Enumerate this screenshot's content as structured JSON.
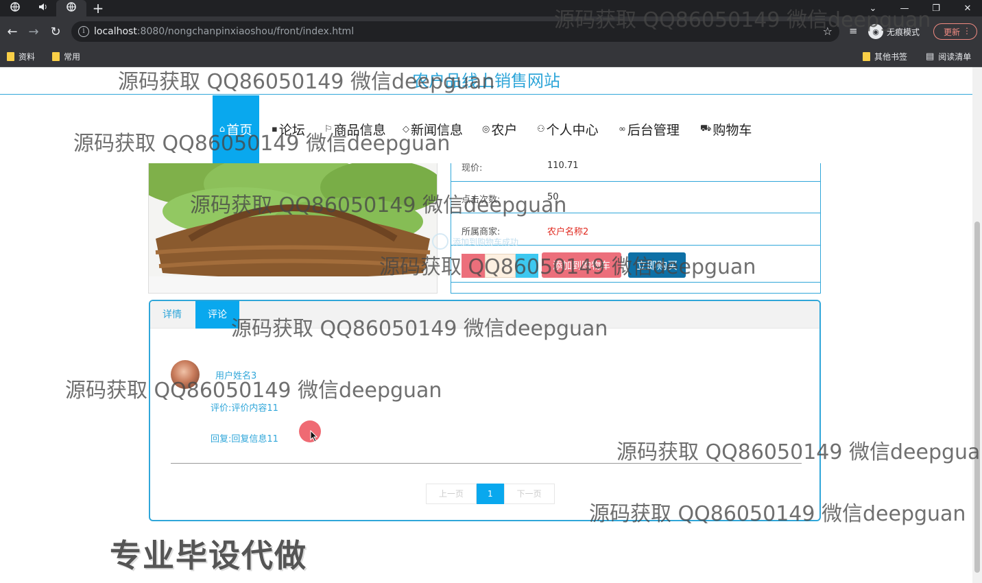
{
  "browser": {
    "tabs": [
      {
        "icon": "globe-icon"
      },
      {
        "icon": "speaker-icon"
      },
      {
        "icon": "globe-icon"
      }
    ],
    "new_tab": "+",
    "url_host": "localhost",
    "url_rest": ":8080/nongchanpinxiaoshou/front/index.html",
    "incognito_label": "无痕模式",
    "update_label": "更新",
    "bookmarks": [
      "资料",
      "常用"
    ],
    "bookmarks_right": [
      "其他书签",
      "阅读清单"
    ]
  },
  "site": {
    "title": "农户品线上销售网站",
    "nav": [
      {
        "label": "首页",
        "icon": "home-icon",
        "active": true
      },
      {
        "label": "论坛",
        "icon": "forum-icon"
      },
      {
        "label": "商品信息",
        "icon": "flag-icon"
      },
      {
        "label": "新闻信息",
        "icon": "tag-icon"
      },
      {
        "label": "农户",
        "icon": "globe-icon"
      },
      {
        "label": "个人中心",
        "icon": "user-icon"
      },
      {
        "label": "后台管理",
        "icon": "link-icon"
      },
      {
        "label": "购物车",
        "icon": "cart-icon"
      }
    ]
  },
  "product": {
    "price_label": "现价:",
    "price_value": "110.71",
    "clicks_label": "点击次数:",
    "clicks_value": "50",
    "merchant_label": "所属商家:",
    "merchant_value": "农户名称2",
    "add_cart_label": "添加到购物车",
    "buy_now_label": "立即购买",
    "toast_text": "添加到购物车成功"
  },
  "comments": {
    "tabs": [
      "详情",
      "评论"
    ],
    "active_tab": 1,
    "items": [
      {
        "user": "用户姓名3",
        "content": "评价:评价内容11",
        "reply": "回复:回复信息11"
      }
    ],
    "pager": {
      "prev": "上一页",
      "current": "1",
      "next": "下一页"
    }
  },
  "watermark": "源码获取 QQ86050149 微信deepguan",
  "promo": "专业毕设代做",
  "colors": {
    "accent": "#09a8ee",
    "title": "#2fa6d9",
    "price_red": "#e0281e",
    "cart_btn": "#ec6f7b",
    "buy_btn": "#0e70a6"
  }
}
